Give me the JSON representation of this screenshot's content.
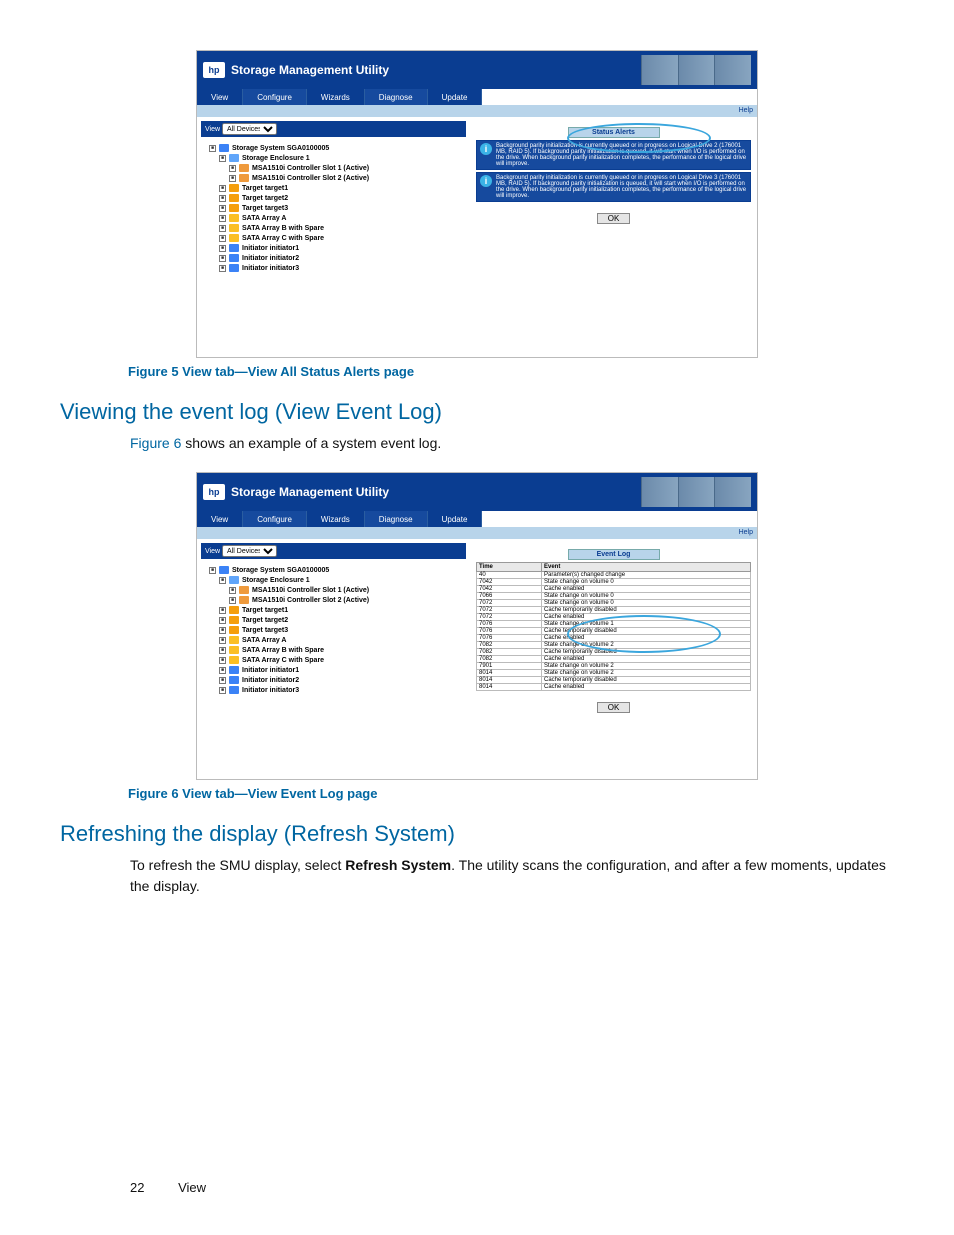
{
  "figure5": {
    "app_title": "Storage Management Utility",
    "tabs": [
      "View",
      "Configure",
      "Wizards",
      "Diagnose",
      "Update"
    ],
    "help_label": "Help",
    "view_label": "View",
    "view_dropdown": "All Devices",
    "tree": [
      {
        "label": "Storage System SGA0100005",
        "cls": "lv0",
        "ico": "ico"
      },
      {
        "label": "Storage Enclosure 1",
        "cls": "lv1",
        "ico": "ico enc"
      },
      {
        "label": "MSA1510i Controller Slot 1 (Active)",
        "cls": "lv2",
        "ico": "ico ctrl"
      },
      {
        "label": "MSA1510i Controller Slot 2 (Active)",
        "cls": "lv2",
        "ico": "ico ctrl"
      },
      {
        "label": "Target target1",
        "cls": "lv1",
        "ico": "ico tgt"
      },
      {
        "label": "Target target2",
        "cls": "lv1",
        "ico": "ico tgt"
      },
      {
        "label": "Target target3",
        "cls": "lv1",
        "ico": "ico tgt"
      },
      {
        "label": "SATA Array A",
        "cls": "lv1",
        "ico": "ico arr"
      },
      {
        "label": "SATA Array B with Spare",
        "cls": "lv1",
        "ico": "ico arr"
      },
      {
        "label": "SATA Array C with Spare",
        "cls": "lv1",
        "ico": "ico arr"
      },
      {
        "label": "Initiator initiator1",
        "cls": "lv1",
        "ico": "ico ini"
      },
      {
        "label": "Initiator initiator2",
        "cls": "lv1",
        "ico": "ico ini"
      },
      {
        "label": "Initiator initiator3",
        "cls": "lv1",
        "ico": "ico ini"
      }
    ],
    "panel_title": "Status Alerts",
    "alerts": [
      "Background parity initialization is currently queued or in progress on Logical Drive 2 (176001 MB, RAID 5). If background parity initialization is queued, it will start when I/O is performed on the drive. When background parity initialization completes, the performance of the logical drive will improve.",
      "Background parity initialization is currently queued or in progress on Logical Drive 3 (176001 MB, RAID 5). If background parity initialization is queued, it will start when I/O is performed on the drive. When background parity initialization completes, the performance of the logical drive will improve."
    ],
    "ok_label": "OK",
    "caption": "Figure 5 View tab—View All Status Alerts page"
  },
  "section1": {
    "heading": "Viewing the event log (View Event Log)",
    "intro_link": "Figure 6",
    "intro_rest": " shows an example of a system event log."
  },
  "figure6": {
    "app_title": "Storage Management Utility",
    "tabs": [
      "View",
      "Configure",
      "Wizards",
      "Diagnose",
      "Update"
    ],
    "help_label": "Help",
    "view_label": "View",
    "view_dropdown": "All Devices",
    "tree": [
      {
        "label": "Storage System SGA0100005",
        "cls": "lv0",
        "ico": "ico"
      },
      {
        "label": "Storage Enclosure 1",
        "cls": "lv1",
        "ico": "ico enc"
      },
      {
        "label": "MSA1510i Controller Slot 1 (Active)",
        "cls": "lv2",
        "ico": "ico ctrl"
      },
      {
        "label": "MSA1510i Controller Slot 2 (Active)",
        "cls": "lv2",
        "ico": "ico ctrl"
      },
      {
        "label": "Target target1",
        "cls": "lv1",
        "ico": "ico tgt"
      },
      {
        "label": "Target target2",
        "cls": "lv1",
        "ico": "ico tgt"
      },
      {
        "label": "Target target3",
        "cls": "lv1",
        "ico": "ico tgt"
      },
      {
        "label": "SATA Array A",
        "cls": "lv1",
        "ico": "ico arr"
      },
      {
        "label": "SATA Array B with Spare",
        "cls": "lv1",
        "ico": "ico arr"
      },
      {
        "label": "SATA Array C with Spare",
        "cls": "lv1",
        "ico": "ico arr"
      },
      {
        "label": "Initiator initiator1",
        "cls": "lv1",
        "ico": "ico ini"
      },
      {
        "label": "Initiator initiator2",
        "cls": "lv1",
        "ico": "ico ini"
      },
      {
        "label": "Initiator initiator3",
        "cls": "lv1",
        "ico": "ico ini"
      }
    ],
    "panel_title": "Event Log",
    "columns": [
      "Time",
      "Event"
    ],
    "rows": [
      {
        "time": "40",
        "event": "Parameter(s) changed change"
      },
      {
        "time": "7042",
        "event": "State change on volume 0"
      },
      {
        "time": "7042",
        "event": "Cache enabled"
      },
      {
        "time": "7066",
        "event": "State change on volume 0"
      },
      {
        "time": "7072",
        "event": "State change on volume 0"
      },
      {
        "time": "7072",
        "event": "Cache temporarily disabled"
      },
      {
        "time": "7072",
        "event": "Cache enabled"
      },
      {
        "time": "7076",
        "event": "State change on volume 1"
      },
      {
        "time": "7076",
        "event": "Cache temporarily disabled"
      },
      {
        "time": "7076",
        "event": "Cache enabled"
      },
      {
        "time": "7082",
        "event": "State change on volume 2"
      },
      {
        "time": "7082",
        "event": "Cache temporarily disabled"
      },
      {
        "time": "7082",
        "event": "Cache enabled"
      },
      {
        "time": "7901",
        "event": "State change on volume 2"
      },
      {
        "time": "8014",
        "event": "State change on volume 2"
      },
      {
        "time": "8014",
        "event": "Cache temporarily disabled"
      },
      {
        "time": "8014",
        "event": "Cache enabled"
      }
    ],
    "ok_label": "OK",
    "caption": "Figure 6 View tab—View Event Log page"
  },
  "section2": {
    "heading": "Refreshing the display (Refresh System)",
    "text_pre": "To refresh the SMU display, select ",
    "text_bold": "Refresh System",
    "text_post": ". The utility scans the configuration, and after a few moments, updates the display."
  },
  "footer": {
    "page": "22",
    "section": "View"
  }
}
